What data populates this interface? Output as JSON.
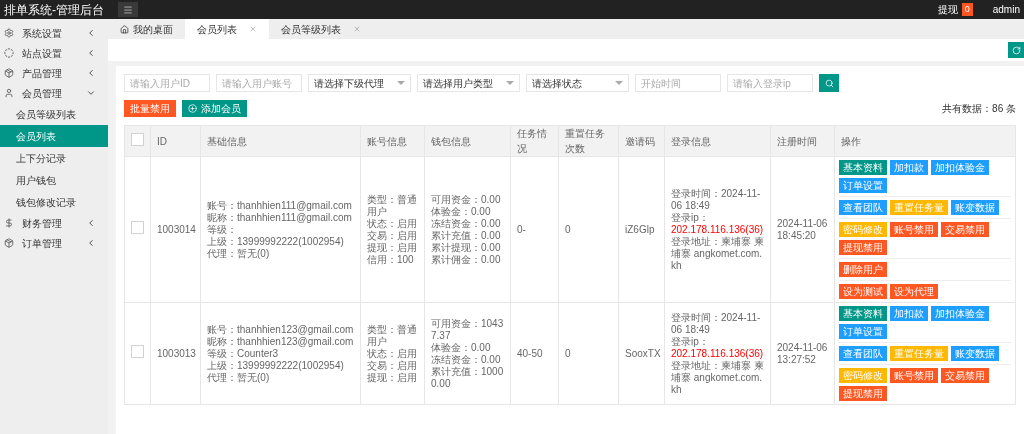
{
  "topbar": {
    "title": "排单系统-管理后台",
    "withdraw_label": "提现",
    "withdraw_count": "0",
    "user": "admin"
  },
  "sidebar": {
    "items": [
      {
        "label": "系统设置",
        "expanded": false
      },
      {
        "label": "站点设置",
        "expanded": false
      },
      {
        "label": "产品管理",
        "expanded": false
      },
      {
        "label": "会员管理",
        "expanded": true,
        "children": [
          {
            "label": "会员等级列表",
            "selected": false
          },
          {
            "label": "会员列表",
            "selected": true
          },
          {
            "label": "上下分记录",
            "selected": false
          },
          {
            "label": "用户钱包",
            "selected": false
          },
          {
            "label": "钱包修改记录",
            "selected": false
          }
        ]
      },
      {
        "label": "财务管理",
        "expanded": false
      },
      {
        "label": "订单管理",
        "expanded": false
      }
    ]
  },
  "tabs": [
    {
      "label": "我的桌面",
      "selected": false,
      "closable": false
    },
    {
      "label": "会员列表",
      "selected": true,
      "closable": true
    },
    {
      "label": "会员等级列表",
      "selected": false,
      "closable": true
    }
  ],
  "filters": [
    {
      "kind": "input",
      "placeholder": "请输入用户ID"
    },
    {
      "kind": "input",
      "placeholder": "请输入用户账号"
    },
    {
      "kind": "select",
      "value": "请选择下级代理"
    },
    {
      "kind": "select",
      "value": "请选择用户类型"
    },
    {
      "kind": "select",
      "value": "请选择状态"
    },
    {
      "kind": "input",
      "placeholder": "开始时间"
    },
    {
      "kind": "input",
      "placeholder": "请输入登录ip"
    }
  ],
  "actions": [
    {
      "label": "批量禁用",
      "kind": "danger"
    },
    {
      "label": "添加会员",
      "kind": "primary"
    }
  ],
  "total": "共有数据：86 条",
  "table": {
    "columns": [
      "ID",
      "基础信息",
      "账号信息",
      "钱包信息",
      "任务情况",
      "重置任务次数",
      "邀请码",
      "登录信息",
      "注册时间",
      "操作"
    ],
    "header_checked": false,
    "rows": [
      {
        "checked": false,
        "id": "1003014",
        "basic": [
          "账号：thanhhien111@gmail.com",
          "昵称：thanhhien111@gmail.com",
          "等级：",
          "上级：13999992222(1002954)",
          "代理：暂无(0)"
        ],
        "account": [
          "类型：普通用户",
          "状态：启用",
          "交易：启用",
          "提现：启用",
          "信用：100"
        ],
        "wallet": [
          "可用资金：0.00",
          "体验金：0.00",
          "冻结资金：0.00",
          "累计充值：0.00",
          "累计提现：0.00",
          "累计佣金：0.00"
        ],
        "task": "0-",
        "reset": "0",
        "invite": "iZ6Glp",
        "login": {
          "time": "登录时间：2024-11-06 18:49",
          "ip_label": "登录ip：",
          "ip": "202.178.116.136(36)",
          "address": "登录地址：柬埔寨 柬埔寨 angkomet.com.kh"
        },
        "registered": "2024-11-06 18:45:20",
        "action_groups": [
          [
            {
              "label": "基本资料",
              "kind": "primary"
            },
            {
              "label": "加扣款",
              "kind": "info"
            },
            {
              "label": "加扣体验金",
              "kind": "info"
            },
            {
              "label": "订单设置",
              "kind": "info"
            }
          ],
          [
            {
              "label": "查看团队",
              "kind": "info"
            },
            {
              "label": "重置任务量",
              "kind": "warn"
            },
            {
              "label": "账变数据",
              "kind": "info"
            }
          ],
          [
            {
              "label": "密码修改",
              "kind": "warn"
            },
            {
              "label": "账号禁用",
              "kind": "danger"
            },
            {
              "label": "交易禁用",
              "kind": "danger"
            },
            {
              "label": "提现禁用",
              "kind": "danger"
            }
          ],
          [
            {
              "label": "删除用户",
              "kind": "danger"
            }
          ],
          [
            {
              "label": "设为测试",
              "kind": "danger"
            },
            {
              "label": "设为代理",
              "kind": "danger"
            }
          ]
        ]
      },
      {
        "checked": false,
        "id": "1003013",
        "basic": [
          "账号：thanhhien123@gmail.com",
          "昵称：thanhhien123@gmail.com",
          "等级：Counter3",
          "上级：13999992222(1002954)",
          "代理：暂无(0)"
        ],
        "account": [
          "类型：普通用户",
          "状态：启用",
          "交易：启用",
          "提现：启用"
        ],
        "wallet": [
          "可用资金：10437.37",
          "体验金：0.00",
          "冻结资金：0.00",
          "累计充值：10000.00"
        ],
        "task": "40-50",
        "reset": "0",
        "invite": "SooxTX",
        "login": {
          "time": "登录时间：2024-11-06 18:49",
          "ip_label": "登录ip：",
          "ip": "202.178.116.136(36)",
          "address": "登录地址：柬埔寨 柬埔寨 angkomet.com.kh"
        },
        "registered": "2024-11-06 13:27:52",
        "action_groups": [
          [
            {
              "label": "基本资料",
              "kind": "primary"
            },
            {
              "label": "加扣款",
              "kind": "info"
            },
            {
              "label": "加扣体验金",
              "kind": "info"
            },
            {
              "label": "订单设置",
              "kind": "info"
            }
          ],
          [
            {
              "label": "查看团队",
              "kind": "info"
            },
            {
              "label": "重置任务量",
              "kind": "warn"
            },
            {
              "label": "账变数据",
              "kind": "info"
            }
          ],
          [
            {
              "label": "密码修改",
              "kind": "warn"
            },
            {
              "label": "账号禁用",
              "kind": "danger"
            },
            {
              "label": "交易禁用",
              "kind": "danger"
            },
            {
              "label": "提现禁用",
              "kind": "danger"
            }
          ]
        ]
      }
    ]
  }
}
